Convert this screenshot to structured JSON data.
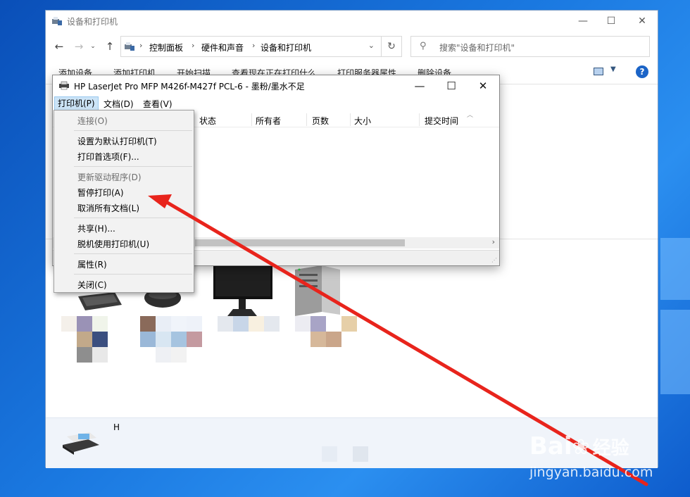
{
  "explorer": {
    "title": "设备和打印机",
    "breadcrumbs": [
      "控制面板",
      "硬件和声音",
      "设备和打印机"
    ],
    "search_placeholder": "搜索\"设备和打印机\"",
    "commands": [
      "添加设备",
      "添加打印机",
      "开始扫描",
      "查看现在正在打印什么",
      "打印服务器属性",
      "删除设备"
    ],
    "bottom_device_name": "H"
  },
  "queue": {
    "title": "HP LaserJet Pro MFP M426f-M427f PCL-6 - 墨粉/墨水不足",
    "menus": [
      "打印机(P)",
      "文档(D)",
      "查看(V)"
    ],
    "columns": [
      "状态",
      "所有者",
      "页数",
      "大小",
      "提交时间"
    ]
  },
  "printer_menu": {
    "groups": [
      [
        {
          "label": "连接(O)",
          "enabled": false
        }
      ],
      [
        {
          "label": "设置为默认打印机(T)",
          "enabled": true
        },
        {
          "label": "打印首选项(F)...",
          "enabled": true
        }
      ],
      [
        {
          "label": "更新驱动程序(D)",
          "enabled": false
        },
        {
          "label": "暂停打印(A)",
          "enabled": true
        },
        {
          "label": "取消所有文档(L)",
          "enabled": true
        }
      ],
      [
        {
          "label": "共享(H)...",
          "enabled": true
        },
        {
          "label": "脱机使用打印机(U)",
          "enabled": true
        }
      ],
      [
        {
          "label": "属性(R)",
          "enabled": true
        }
      ],
      [
        {
          "label": "关闭(C)",
          "enabled": true
        }
      ]
    ]
  },
  "annotation": {
    "color": "#e8241c",
    "target_item": "暂停打印(A)"
  },
  "watermark": {
    "brand": "Bai",
    "brand_cn": "经验",
    "url": "jingyan.baidu.com"
  }
}
